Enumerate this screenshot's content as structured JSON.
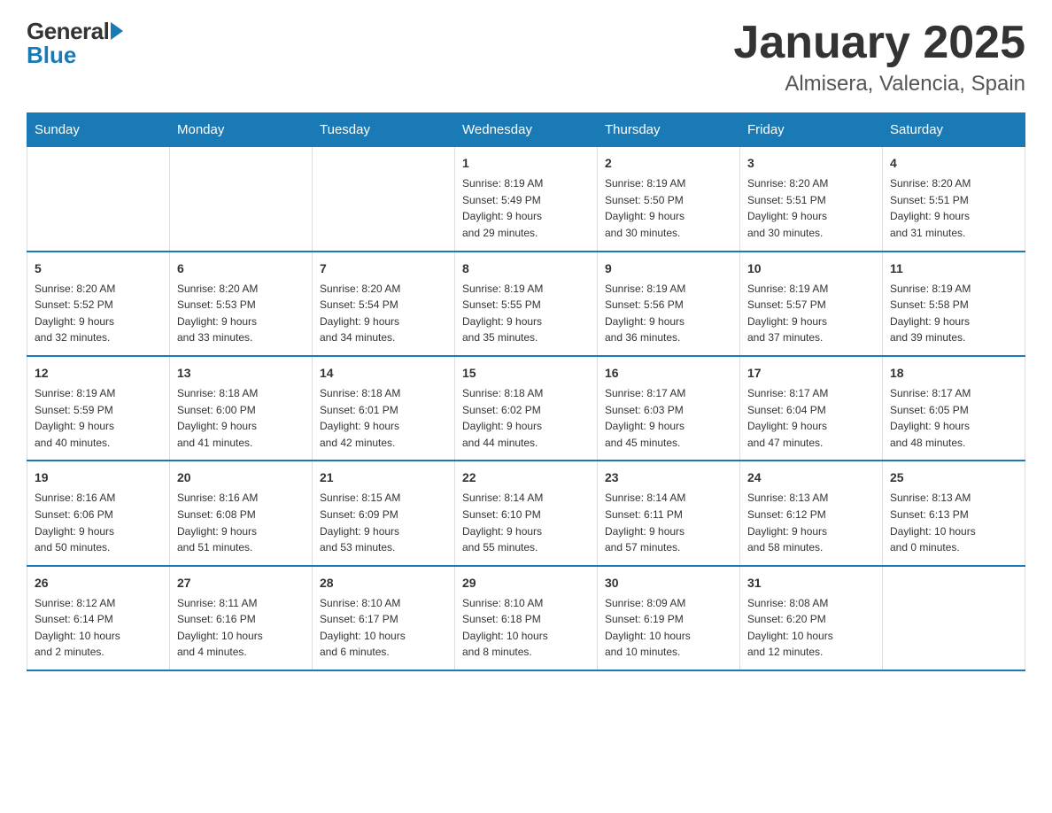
{
  "header": {
    "logo": {
      "general": "General",
      "blue": "Blue"
    },
    "title": "January 2025",
    "subtitle": "Almisera, Valencia, Spain"
  },
  "days_of_week": [
    "Sunday",
    "Monday",
    "Tuesday",
    "Wednesday",
    "Thursday",
    "Friday",
    "Saturday"
  ],
  "weeks": [
    [
      {
        "day": "",
        "info": ""
      },
      {
        "day": "",
        "info": ""
      },
      {
        "day": "",
        "info": ""
      },
      {
        "day": "1",
        "info": "Sunrise: 8:19 AM\nSunset: 5:49 PM\nDaylight: 9 hours\nand 29 minutes."
      },
      {
        "day": "2",
        "info": "Sunrise: 8:19 AM\nSunset: 5:50 PM\nDaylight: 9 hours\nand 30 minutes."
      },
      {
        "day": "3",
        "info": "Sunrise: 8:20 AM\nSunset: 5:51 PM\nDaylight: 9 hours\nand 30 minutes."
      },
      {
        "day": "4",
        "info": "Sunrise: 8:20 AM\nSunset: 5:51 PM\nDaylight: 9 hours\nand 31 minutes."
      }
    ],
    [
      {
        "day": "5",
        "info": "Sunrise: 8:20 AM\nSunset: 5:52 PM\nDaylight: 9 hours\nand 32 minutes."
      },
      {
        "day": "6",
        "info": "Sunrise: 8:20 AM\nSunset: 5:53 PM\nDaylight: 9 hours\nand 33 minutes."
      },
      {
        "day": "7",
        "info": "Sunrise: 8:20 AM\nSunset: 5:54 PM\nDaylight: 9 hours\nand 34 minutes."
      },
      {
        "day": "8",
        "info": "Sunrise: 8:19 AM\nSunset: 5:55 PM\nDaylight: 9 hours\nand 35 minutes."
      },
      {
        "day": "9",
        "info": "Sunrise: 8:19 AM\nSunset: 5:56 PM\nDaylight: 9 hours\nand 36 minutes."
      },
      {
        "day": "10",
        "info": "Sunrise: 8:19 AM\nSunset: 5:57 PM\nDaylight: 9 hours\nand 37 minutes."
      },
      {
        "day": "11",
        "info": "Sunrise: 8:19 AM\nSunset: 5:58 PM\nDaylight: 9 hours\nand 39 minutes."
      }
    ],
    [
      {
        "day": "12",
        "info": "Sunrise: 8:19 AM\nSunset: 5:59 PM\nDaylight: 9 hours\nand 40 minutes."
      },
      {
        "day": "13",
        "info": "Sunrise: 8:18 AM\nSunset: 6:00 PM\nDaylight: 9 hours\nand 41 minutes."
      },
      {
        "day": "14",
        "info": "Sunrise: 8:18 AM\nSunset: 6:01 PM\nDaylight: 9 hours\nand 42 minutes."
      },
      {
        "day": "15",
        "info": "Sunrise: 8:18 AM\nSunset: 6:02 PM\nDaylight: 9 hours\nand 44 minutes."
      },
      {
        "day": "16",
        "info": "Sunrise: 8:17 AM\nSunset: 6:03 PM\nDaylight: 9 hours\nand 45 minutes."
      },
      {
        "day": "17",
        "info": "Sunrise: 8:17 AM\nSunset: 6:04 PM\nDaylight: 9 hours\nand 47 minutes."
      },
      {
        "day": "18",
        "info": "Sunrise: 8:17 AM\nSunset: 6:05 PM\nDaylight: 9 hours\nand 48 minutes."
      }
    ],
    [
      {
        "day": "19",
        "info": "Sunrise: 8:16 AM\nSunset: 6:06 PM\nDaylight: 9 hours\nand 50 minutes."
      },
      {
        "day": "20",
        "info": "Sunrise: 8:16 AM\nSunset: 6:08 PM\nDaylight: 9 hours\nand 51 minutes."
      },
      {
        "day": "21",
        "info": "Sunrise: 8:15 AM\nSunset: 6:09 PM\nDaylight: 9 hours\nand 53 minutes."
      },
      {
        "day": "22",
        "info": "Sunrise: 8:14 AM\nSunset: 6:10 PM\nDaylight: 9 hours\nand 55 minutes."
      },
      {
        "day": "23",
        "info": "Sunrise: 8:14 AM\nSunset: 6:11 PM\nDaylight: 9 hours\nand 57 minutes."
      },
      {
        "day": "24",
        "info": "Sunrise: 8:13 AM\nSunset: 6:12 PM\nDaylight: 9 hours\nand 58 minutes."
      },
      {
        "day": "25",
        "info": "Sunrise: 8:13 AM\nSunset: 6:13 PM\nDaylight: 10 hours\nand 0 minutes."
      }
    ],
    [
      {
        "day": "26",
        "info": "Sunrise: 8:12 AM\nSunset: 6:14 PM\nDaylight: 10 hours\nand 2 minutes."
      },
      {
        "day": "27",
        "info": "Sunrise: 8:11 AM\nSunset: 6:16 PM\nDaylight: 10 hours\nand 4 minutes."
      },
      {
        "day": "28",
        "info": "Sunrise: 8:10 AM\nSunset: 6:17 PM\nDaylight: 10 hours\nand 6 minutes."
      },
      {
        "day": "29",
        "info": "Sunrise: 8:10 AM\nSunset: 6:18 PM\nDaylight: 10 hours\nand 8 minutes."
      },
      {
        "day": "30",
        "info": "Sunrise: 8:09 AM\nSunset: 6:19 PM\nDaylight: 10 hours\nand 10 minutes."
      },
      {
        "day": "31",
        "info": "Sunrise: 8:08 AM\nSunset: 6:20 PM\nDaylight: 10 hours\nand 12 minutes."
      },
      {
        "day": "",
        "info": ""
      }
    ]
  ]
}
